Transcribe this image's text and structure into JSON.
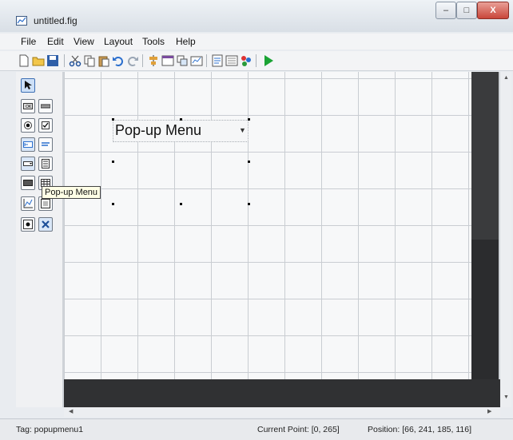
{
  "window": {
    "title": "untitled.fig"
  },
  "window_buttons": {
    "min": "–",
    "max": "□",
    "close": "X"
  },
  "menu": [
    {
      "label": "File"
    },
    {
      "label": "Edit"
    },
    {
      "label": "View"
    },
    {
      "label": "Layout"
    },
    {
      "label": "Tools"
    },
    {
      "label": "Help"
    }
  ],
  "toolbar_icons": [
    "new-icon",
    "open-icon",
    "save-icon",
    "cut-icon",
    "copy-icon",
    "paste-icon",
    "undo-icon",
    "redo-icon",
    "align-icon",
    "menu-editor-icon",
    "tab-order-icon",
    "toolbar-editor-icon",
    "m-file-editor-icon",
    "property-inspector-icon",
    "object-browser-icon",
    "run-icon"
  ],
  "palette_icons": [
    "select-tool-icon",
    "push-button-icon",
    "slider-icon",
    "radio-button-icon",
    "checkbox-icon",
    "edit-text-icon",
    "static-text-icon",
    "popup-menu-icon",
    "listbox-icon",
    "toggle-button-icon",
    "table-icon",
    "axes-icon",
    "panel-icon",
    "button-group-icon",
    "activex-control-icon"
  ],
  "component": {
    "label": "Pop-up Menu"
  },
  "tooltip": {
    "text": "Pop-up Menu"
  },
  "status": {
    "tag": "Tag: popupmenu1",
    "current_point": "Current Point:  [0, 265]",
    "position": "Position: [66, 241, 185, 116]"
  },
  "colors": {
    "run_green": "#1aa334",
    "selection_blue": "#3d6fb3"
  }
}
